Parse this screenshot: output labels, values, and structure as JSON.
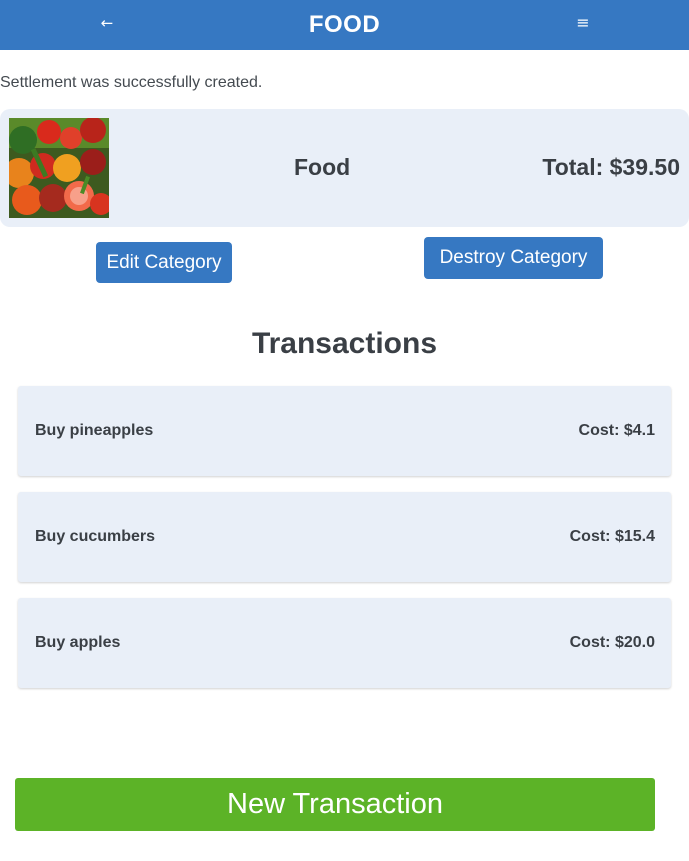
{
  "header": {
    "back_icon": "←",
    "title": "FOOD",
    "menu_icon": "≡"
  },
  "notice": "Settlement was successfully created.",
  "category": {
    "image_icon": "vegetables-photo",
    "name": "Food",
    "total": "Total: $39.50"
  },
  "actions": {
    "edit_label": "Edit Category",
    "destroy_label": "Destroy Category"
  },
  "transactions_title": "Transactions",
  "transactions": [
    {
      "name": "Buy pineapples",
      "cost": "Cost: $4.1"
    },
    {
      "name": "Buy cucumbers",
      "cost": "Cost: $15.4"
    },
    {
      "name": "Buy apples",
      "cost": "Cost: $20.0"
    }
  ],
  "new_transaction_label": "New Transaction",
  "colors": {
    "header_bg": "#3678c2",
    "card_bg": "#e9eff8",
    "button_blue": "#3678c2",
    "button_green": "#5cb327"
  }
}
